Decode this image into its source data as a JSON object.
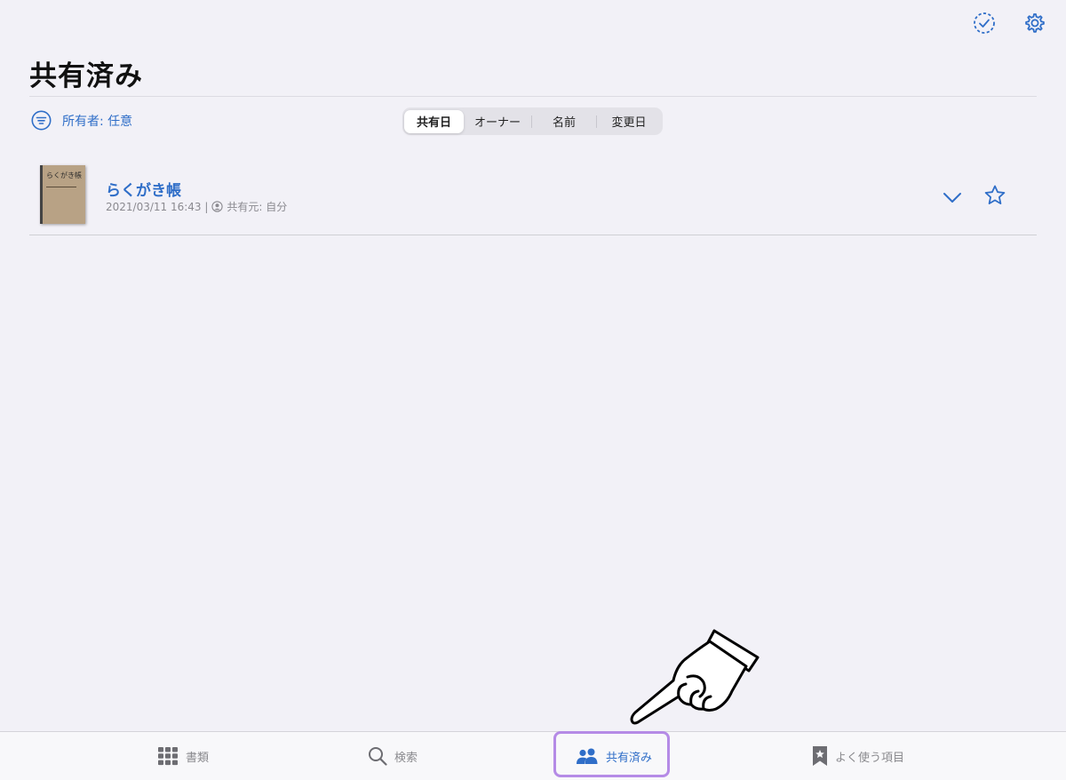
{
  "header": {
    "title": "共有済み",
    "icons": {
      "select": "dashed-circle-check-icon",
      "settings": "gear-icon"
    }
  },
  "filter": {
    "label": "所有者: 任意",
    "icon": "filter-lines-icon"
  },
  "sort": {
    "options": [
      "共有日",
      "オーナー",
      "名前",
      "変更日"
    ],
    "selected": "共有日"
  },
  "documents": [
    {
      "title": "らくがき帳",
      "date": "2021/03/11 16:43 |",
      "shared_from": "共有元: 自分",
      "thumbnail_text": "らくがき帳"
    }
  ],
  "tabbar": {
    "items": [
      {
        "label": "書類",
        "icon": "grid-icon"
      },
      {
        "label": "検索",
        "icon": "search-icon"
      },
      {
        "label": "共有済み",
        "icon": "people-icon",
        "active": true
      },
      {
        "label": "よく使う項目",
        "icon": "bookmark-star-icon"
      }
    ]
  },
  "colors": {
    "accent": "#2f6ec8",
    "highlight": "#b58be6",
    "background": "#f2f1f7"
  }
}
